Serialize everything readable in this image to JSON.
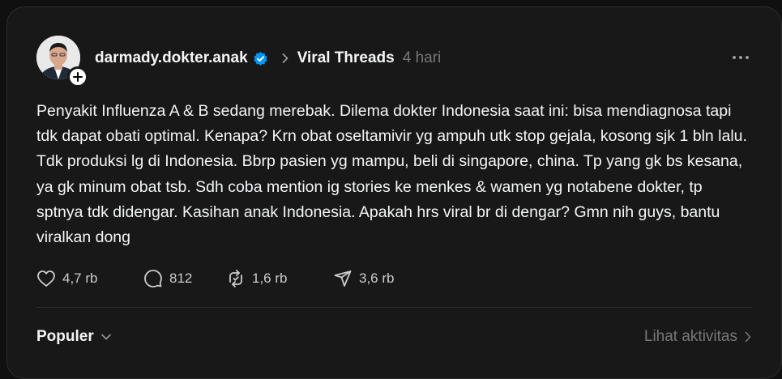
{
  "post": {
    "author": "darmady.dokter.anak",
    "community": "Viral Threads",
    "time": "4 hari",
    "text": "Penyakit Influenza A & B sedang merebak. Dilema dokter Indonesia saat ini: bisa mendiagnosa tapi tdk dapat obati optimal. Kenapa? Krn obat oseltamivir yg ampuh utk stop gejala, kosong sjk 1 bln lalu. Tdk produksi lg di Indonesia. Bbrp pasien yg mampu, beli di singapore, china. Tp yang gk bs kesana, ya gk minum obat tsb. Sdh coba mention ig stories ke menkes & wamen yg notabene dokter, tp sptnya tdk didengar. Kasihan anak Indonesia. Apakah hrs viral br di dengar? Gmn nih guys, bantu viralkan dong"
  },
  "actions": {
    "likes": "4,7 rb",
    "replies": "812",
    "reposts": "1,6 rb",
    "shares": "3,6 rb"
  },
  "footer": {
    "sort_label": "Populer",
    "activity_label": "Lihat aktivitas"
  },
  "colors": {
    "background": "#181818",
    "text": "#f3f5f7",
    "muted": "#777777",
    "verified": "#0095f6"
  },
  "icons": [
    "avatar",
    "plus-icon",
    "verified-badge-icon",
    "chevron-right-icon",
    "more-icon",
    "heart-icon",
    "comment-icon",
    "repost-icon",
    "share-icon",
    "chevron-down-icon"
  ]
}
